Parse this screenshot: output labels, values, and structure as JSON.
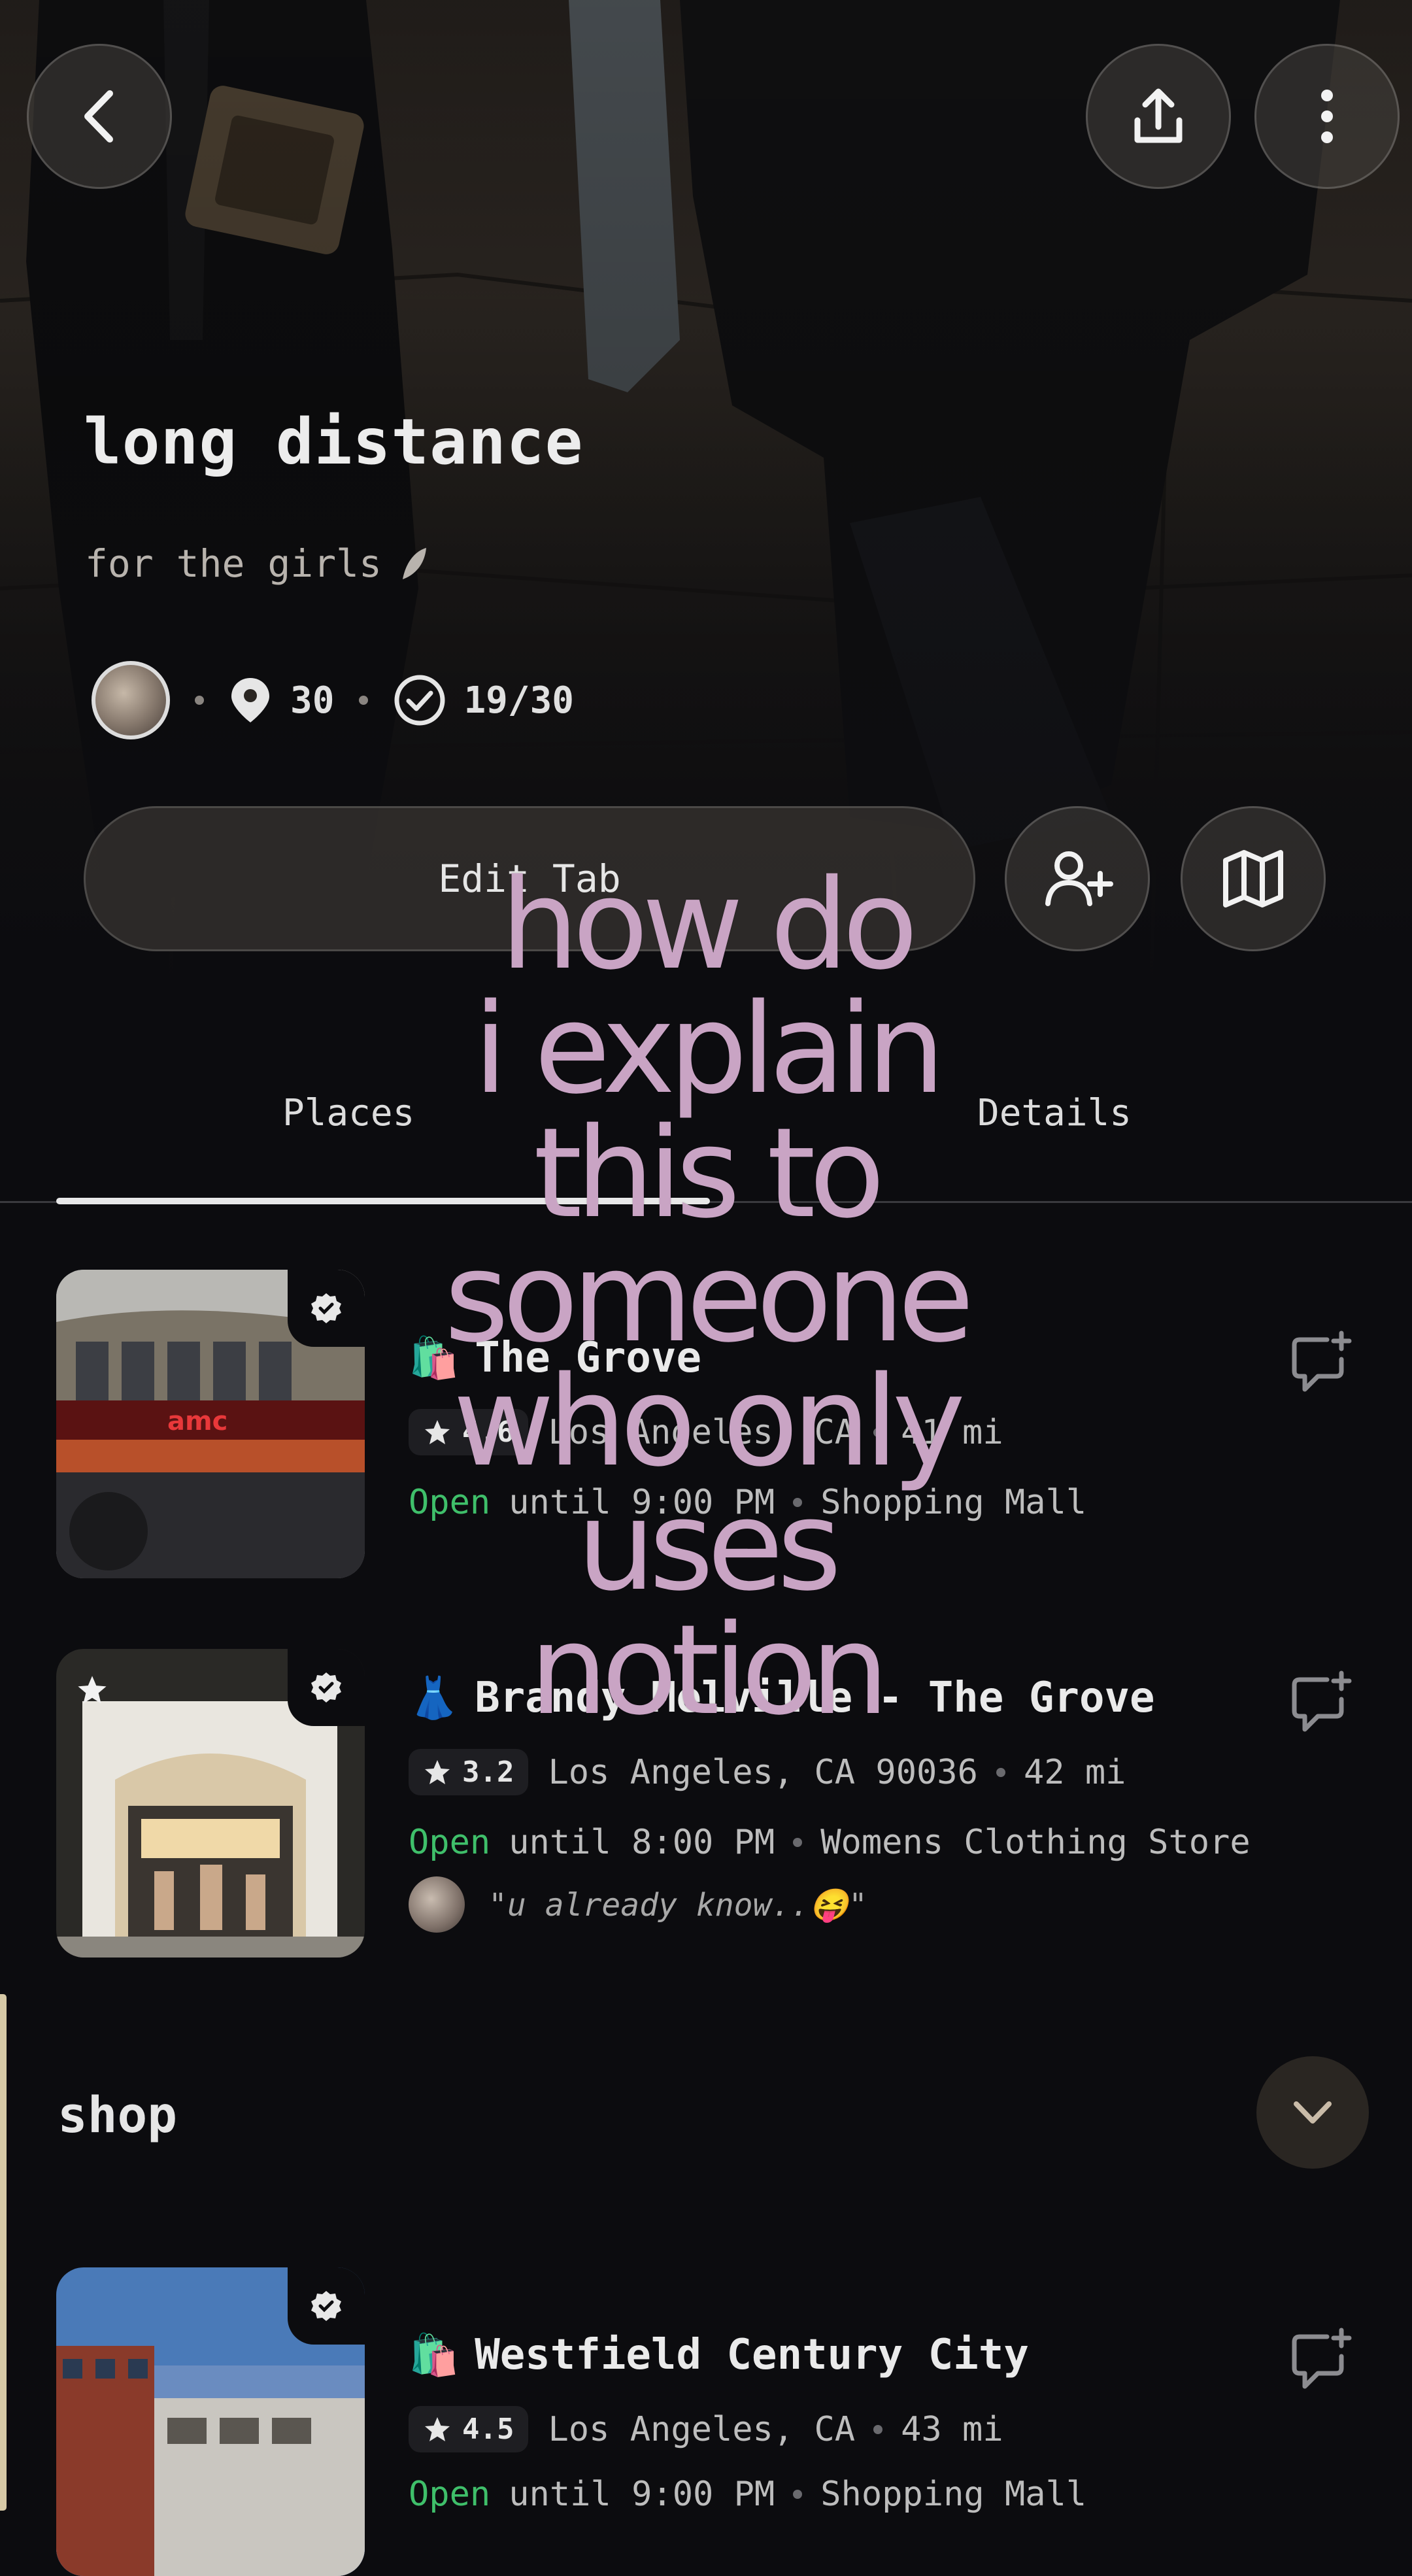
{
  "header": {
    "title": "long distance",
    "subtitle": "for the girls",
    "stats": {
      "places_count": "30",
      "visited": "19/30"
    },
    "edit_button_label": "Edit Tab"
  },
  "tabs": [
    {
      "label": "Places",
      "active": true
    },
    {
      "label": "Details",
      "active": false
    }
  ],
  "places": [
    {
      "emoji": "🛍️",
      "name": "The Grove",
      "rating": "4.6",
      "location": "Los Angeles, CA",
      "distance": "41 mi",
      "status": "Open",
      "hours": "until 9:00 PM",
      "category": "Shopping Mall",
      "image_sign": "amc"
    },
    {
      "emoji": "👗",
      "name": "Brandy Melville - The Grove",
      "rating": "3.2",
      "location": "Los Angeles, CA 90036",
      "distance": "42 mi",
      "status": "Open",
      "hours": "until 8:00 PM",
      "category": "Womens Clothing Store",
      "note": "\"u already know..😝\""
    }
  ],
  "section": {
    "title": "shop"
  },
  "section_places": [
    {
      "emoji": "🛍️",
      "name": "Westfield Century City",
      "rating": "4.5",
      "location": "Los Angeles, CA",
      "distance": "43 mi",
      "status": "Open",
      "hours": "until 9:00 PM",
      "category": "Shopping Mall"
    }
  ],
  "overlay_caption": [
    "how do",
    "i explain",
    "this to",
    "someone",
    "who only",
    "uses notion"
  ],
  "colors": {
    "open": "#3fbf6a",
    "caption": "#c9a4c4",
    "background": "#0c0c0f"
  }
}
